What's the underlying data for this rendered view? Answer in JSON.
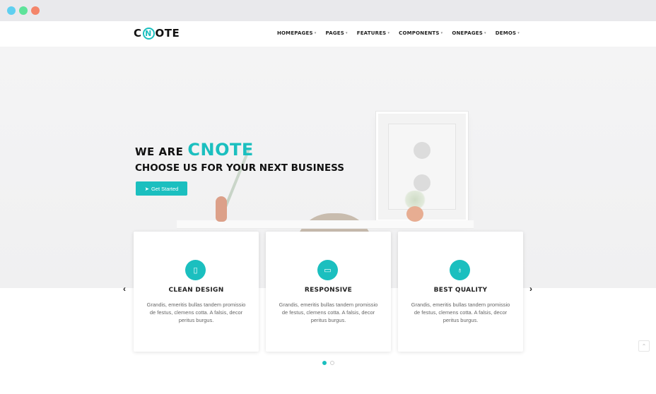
{
  "window": {
    "dots": [
      "#5fcff0",
      "#5ee39a",
      "#f4856a"
    ]
  },
  "nav": {
    "logo": {
      "left": "C",
      "ring": "N",
      "right": "OTE"
    },
    "menu": [
      {
        "label": "HOMEPAGES"
      },
      {
        "label": "PAGES"
      },
      {
        "label": "FEATURES"
      },
      {
        "label": "COMPONENTS"
      },
      {
        "label": "ONEPAGES"
      },
      {
        "label": "DEMOS"
      }
    ]
  },
  "hero": {
    "prefix": "WE ARE",
    "brand": "CNOTE",
    "tagline": "CHOOSE US FOR YOUR NEXT BUSINESS",
    "cta_label": "Get Started"
  },
  "features": [
    {
      "icon": "tablet-icon",
      "title": "CLEAN DESIGN",
      "desc": "Grandis, emeritis bullas tandem promissio de festus, clemens cotta. A falsis, decor peritus burgus."
    },
    {
      "icon": "monitor-icon",
      "title": "RESPONSIVE",
      "desc": "Grandis, emeritis bullas tandem promissio de festus, clemens cotta. A falsis, decor peritus burgus."
    },
    {
      "icon": "lightbulb-icon",
      "title": "BEST QUALITY",
      "desc": "Grandis, emeritis bullas tandem promissio de festus, clemens cotta. A falsis, decor peritus burgus."
    }
  ],
  "colors": {
    "accent": "#1bbfbf"
  },
  "carousel": {
    "pages": 2,
    "active": 1
  }
}
